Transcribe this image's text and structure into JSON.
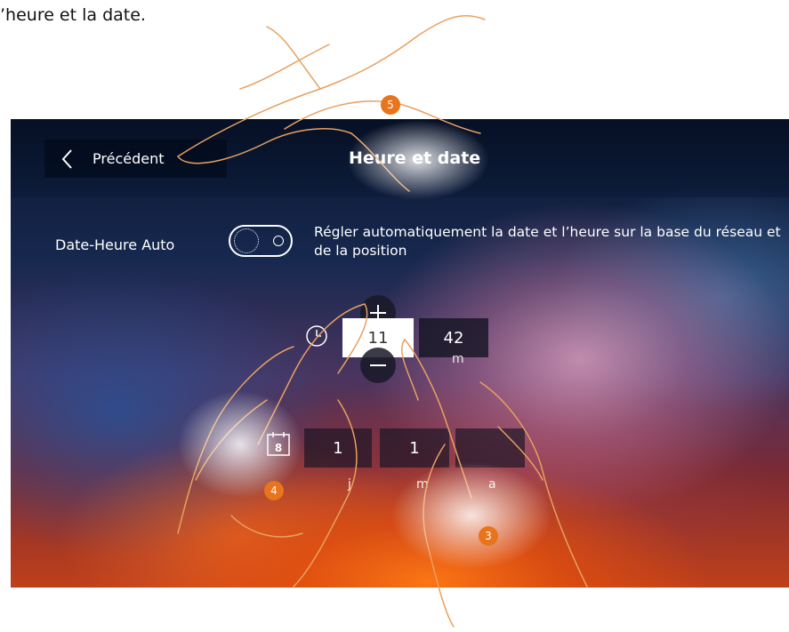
{
  "doc": {
    "caption": "’heure et la date."
  },
  "header": {
    "back_label": "Précédent",
    "title": "Heure et date"
  },
  "auto_setting": {
    "label": "Date-Heure Auto",
    "enabled": false,
    "description": "Régler automatiquement la date et l’heure sur la base du réseau et de la position"
  },
  "time": {
    "hour": "11",
    "minute": "42",
    "minute_unit": "m"
  },
  "date": {
    "day": "1",
    "month": "1",
    "year": "",
    "day_unit": "j",
    "month_unit": "m",
    "year_unit": "a",
    "calendar_number": "8"
  },
  "steps": {
    "five": "5",
    "four": "4",
    "three": "3"
  },
  "colors": {
    "badge": "#e8741c",
    "selected_field": "#ffffff"
  }
}
